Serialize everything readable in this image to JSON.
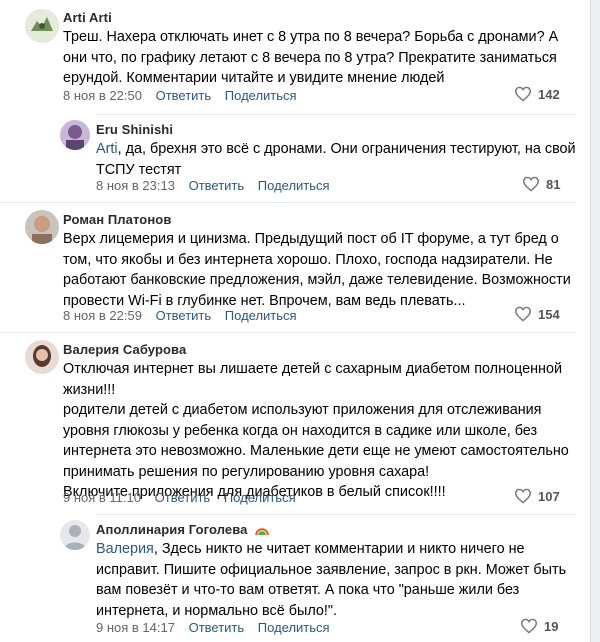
{
  "comments": [
    {
      "author": "Arti Arti",
      "lines": [
        "Треш. Нахера отключать инет с 8 утра по 8 вечера? Борьба с дронами? А",
        "они что, по графику летают с 8 вечера по 8 утра? Прекратите заниматься",
        "ерундой. Комментарии читайте и увидите мнение людей"
      ],
      "date": "8 ноя в 22:50",
      "reply_label": "Ответить",
      "share_label": "Поделиться",
      "likes": "142"
    },
    {
      "author": "Eru Shinishi",
      "mention": "Arti",
      "lines": [
        ", да, брехня это всё с дронами. Они ограничения тестируют, на свой",
        "ТСПУ тестят"
      ],
      "date": "8 ноя в 23:13",
      "reply_label": "Ответить",
      "share_label": "Поделиться",
      "likes": "81"
    },
    {
      "author": "Роман Платонов",
      "lines": [
        "Верх лицемерия и цинизма. Предыдущий пост об IT форуме, а тут бред о",
        "том, что якобы и без интернета хорошо. Плохо, господа надзиратели. Не",
        "работают банковские предложения, мэйл, даже телевидение. Возможности",
        "провести Wi-Fi в глубинке нет. Впрочем, вам ведь плевать..."
      ],
      "date": "8 ноя в 22:59",
      "reply_label": "Ответить",
      "share_label": "Поделиться",
      "likes": "154"
    },
    {
      "author": "Валерия Сабурова",
      "lines": [
        "Отключая интернет вы лишаете детей с сахарным диабетом полноценной",
        "жизни!!!",
        "родители детей с диабетом используют приложения для отслеживания",
        "уровня глюкозы у ребенка когда он находится в садике или школе, без",
        "интернета это невозможно. Маленькие дети еще не умеют самостоятельно",
        "принимать решения по регулированию уровня сахара!",
        "Включите приложения для диабетиков в белый список!!!!"
      ],
      "date": "9 ноя в 11:10",
      "reply_label": "Ответить",
      "share_label": "Поделиться",
      "likes": "107"
    },
    {
      "author": "Аполлинария Гоголева",
      "mention": "Валерия",
      "lines": [
        ", Здесь никто не читает комментарии и никто ничего не",
        "исправит. Пишите официальное заявление, запрос в ркн. Может быть",
        "вам повезёт и что-то вам ответят. А пока что \"раньше жили без",
        "интернета, и нормально всё было!\"."
      ],
      "date": "9 ноя в 14:17",
      "reply_label": "Ответить",
      "share_label": "Поделиться",
      "likes": "19"
    }
  ],
  "icons": {
    "like": "heart-icon",
    "emoji": "rainbow-icon"
  },
  "colors": {
    "link": "#2a5885",
    "meta": "#656565",
    "divider": "#e7e8ec"
  }
}
